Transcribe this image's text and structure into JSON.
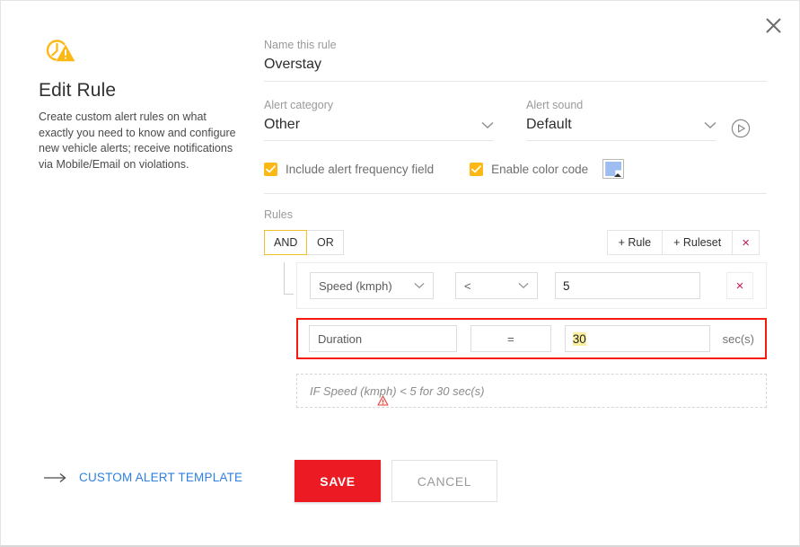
{
  "dialog": {
    "close_icon": "close-icon"
  },
  "left_panel": {
    "icon": "clock-warning-icon",
    "title": "Edit Rule",
    "description": "Create custom alert rules on what exactly you need to know and configure new vehicle alerts; receive notifications via Mobile/Email on violations."
  },
  "form": {
    "name_field": {
      "label": "Name this rule",
      "value": "Overstay",
      "placeholder": "Name this rule"
    },
    "alert_category": {
      "label": "Alert category",
      "value": "Other",
      "chevron_icon": "chevron-down-icon"
    },
    "alert_sound": {
      "label": "Alert sound",
      "value": "Default",
      "chevron_icon": "chevron-down-icon",
      "play_icon": "play-circle-icon"
    },
    "checkboxes": [
      {
        "label": "Include alert frequency field",
        "checked": true
      },
      {
        "label": "Enable color code",
        "checked": true
      }
    ],
    "color_swatch": {
      "name": "color-picker-swatch",
      "color": "#9ebdf0"
    }
  },
  "rules": {
    "label": "Rules",
    "logic": {
      "options": [
        "AND",
        "OR"
      ],
      "selected": "AND",
      "and_label": "AND",
      "or_label": "OR",
      "active_border_color": "#f0c02a"
    },
    "actions": {
      "add_rule_label": "+ Rule",
      "add_ruleset_label": "+ Ruleset",
      "remove_label": "×",
      "remove_color": "#c5185c"
    },
    "rows": [
      {
        "field": "Speed (kmph)",
        "operator": "<",
        "value": "5",
        "unit": "",
        "highlighted": false,
        "has_remove": true
      },
      {
        "field": "Duration",
        "operator": "=",
        "value": "30",
        "unit": "sec(s)",
        "highlighted": true,
        "has_remove": false,
        "highlight_color": "#f51a0d",
        "value_selection_color": "#faf0a0"
      }
    ],
    "summary": "IF Speed (kmph) < 5 for 30 sec(s)",
    "summary_warning_icon": "warning-triangle-icon"
  },
  "footer": {
    "template_link": {
      "arrow_icon": "arrow-right-icon",
      "label": "CUSTOM ALERT TEMPLATE"
    },
    "save_label": "SAVE",
    "cancel_label": "CANCEL",
    "save_color": "#ec1b23"
  }
}
